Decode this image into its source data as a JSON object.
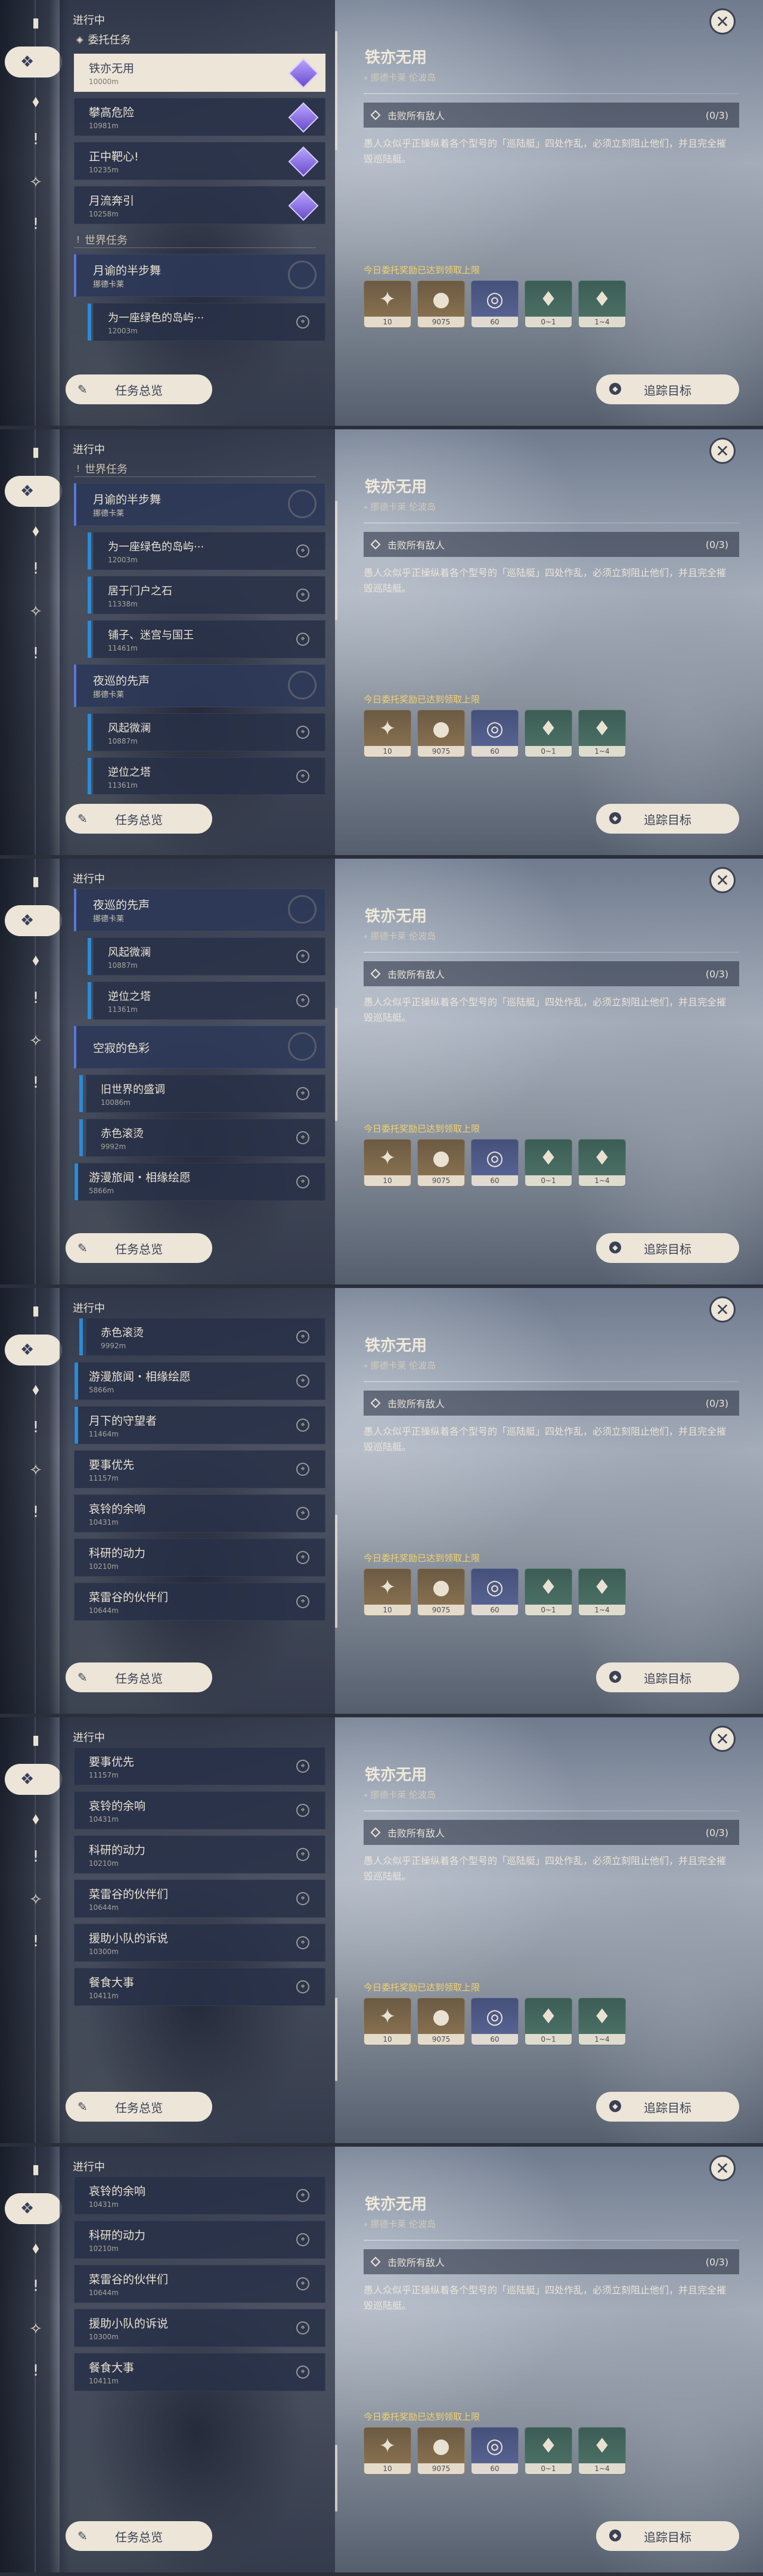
{
  "common": {
    "rail_icons": [
      {
        "name": "book-icon",
        "glyph": "▮"
      },
      {
        "name": "commission-icon",
        "glyph": "❖"
      },
      {
        "name": "archon-icon",
        "glyph": "⬧"
      },
      {
        "name": "exclamation-icon",
        "glyph": "!"
      },
      {
        "name": "crystal-icon",
        "glyph": "✧"
      },
      {
        "name": "exclamation-icon-2",
        "glyph": "!"
      }
    ],
    "in_progress": "进行中",
    "overview_button": "任务总览",
    "track_button": "追踪目标",
    "close_symbol": "✕",
    "detail": {
      "title": "铁亦无用",
      "location": "挪德卡莱 伦波岛",
      "objective": "击败所有敌人",
      "objective_count": "(0/3)",
      "description": "愚人众似乎正操纵着各个型号的「巡陆艇」四处作乱，必须立刻阻止他们，并且完全摧毁巡陆艇。",
      "rewards_label": "今日委托奖励已达到领取上限",
      "rewards": [
        {
          "icon": "star-icon",
          "glyph": "✦",
          "count": "10"
        },
        {
          "icon": "mora-icon",
          "glyph": "●",
          "count": "9075"
        },
        {
          "icon": "exp-icon",
          "glyph": "◎",
          "count": "60"
        },
        {
          "icon": "crystal-icon",
          "glyph": "♦",
          "count": "0~1"
        },
        {
          "icon": "crystal-cluster-icon",
          "glyph": "♦",
          "count": "1~4"
        }
      ]
    }
  },
  "frames": [
    {
      "thumb": "top",
      "items": [
        {
          "kind": "section",
          "icon": "◈",
          "text": "委托任务"
        },
        {
          "kind": "row",
          "style": "sel",
          "title": "铁亦无用",
          "dist": "10000m",
          "badge": "gem"
        },
        {
          "kind": "row",
          "style": "plain",
          "title": "攀高危险",
          "dist": "10981m",
          "badge": "gem"
        },
        {
          "kind": "row",
          "style": "plain",
          "title": "正中靶心!",
          "dist": "10235m",
          "badge": "gem"
        },
        {
          "kind": "row",
          "style": "plain",
          "title": "月流奔引",
          "dist": "10258m",
          "badge": "gem"
        },
        {
          "kind": "section",
          "icon": "!",
          "text": "世界任务",
          "sub": true
        },
        {
          "kind": "group",
          "title": "月谕的半步舞",
          "sub": "挪德卡莱"
        },
        {
          "kind": "child",
          "title": "为一座绿色的岛屿···",
          "dist": "12003m"
        }
      ]
    },
    {
      "thumb": "upper",
      "items": [
        {
          "kind": "section",
          "icon": "!",
          "text": "世界任务",
          "sub": true
        },
        {
          "kind": "group",
          "title": "月谕的半步舞",
          "sub": "挪德卡莱"
        },
        {
          "kind": "child",
          "title": "为一座绿色的岛屿···",
          "dist": "12003m"
        },
        {
          "kind": "child",
          "title": "居于门户之石",
          "dist": "11338m"
        },
        {
          "kind": "child",
          "title": "铺子、迷宫与国王",
          "dist": "11461m"
        },
        {
          "kind": "group",
          "title": "夜巡的先声",
          "sub": "挪德卡莱"
        },
        {
          "kind": "child",
          "title": "风起微澜",
          "dist": "10887m"
        },
        {
          "kind": "child",
          "title": "逆位之塔",
          "dist": "11361m"
        }
      ]
    },
    {
      "thumb": "middle",
      "items": [
        {
          "kind": "group",
          "title": "夜巡的先声",
          "sub": "挪德卡莱"
        },
        {
          "kind": "child",
          "title": "风起微澜",
          "dist": "10887m"
        },
        {
          "kind": "child",
          "title": "逆位之塔",
          "dist": "11361m"
        },
        {
          "kind": "group",
          "title": "空寂的色彩",
          "sub": ""
        },
        {
          "kind": "child",
          "title": "旧世界的盛调",
          "dist": "10086m",
          "plain": true
        },
        {
          "kind": "child",
          "title": "赤色滚烫",
          "dist": "9992m",
          "plain": true
        },
        {
          "kind": "row",
          "style": "blue",
          "title": "游漫旅闻・相缘绘愿",
          "dist": "5866m"
        }
      ]
    },
    {
      "thumb": "lower",
      "items": [
        {
          "kind": "child",
          "title": "赤色滚烫",
          "dist": "9992m",
          "plain": true
        },
        {
          "kind": "row",
          "style": "blue",
          "title": "游漫旅闻・相缘绘愿",
          "dist": "5866m"
        },
        {
          "kind": "row",
          "style": "blue",
          "title": "月下的守望者",
          "dist": "11464m"
        },
        {
          "kind": "row",
          "style": "plain",
          "title": "要事优先",
          "dist": "11157m"
        },
        {
          "kind": "row",
          "style": "plain",
          "title": "哀铃的余响",
          "dist": "10431m"
        },
        {
          "kind": "row",
          "style": "plain",
          "title": "科研的动力",
          "dist": "10210m"
        },
        {
          "kind": "row",
          "style": "plain",
          "title": "菜雷谷的伙伴们",
          "dist": "10644m"
        }
      ]
    },
    {
      "thumb": "bottom",
      "items": [
        {
          "kind": "row",
          "style": "plain",
          "title": "要事优先",
          "dist": "11157m"
        },
        {
          "kind": "row",
          "style": "plain",
          "title": "哀铃的余响",
          "dist": "10431m"
        },
        {
          "kind": "row",
          "style": "plain",
          "title": "科研的动力",
          "dist": "10210m"
        },
        {
          "kind": "row",
          "style": "plain",
          "title": "菜雷谷的伙伴们",
          "dist": "10644m"
        },
        {
          "kind": "row",
          "style": "plain",
          "title": "援助小队的诉说",
          "dist": "10300m"
        },
        {
          "kind": "row",
          "style": "plain",
          "title": "餐食大事",
          "dist": "10411m"
        }
      ]
    },
    {
      "thumb": "end",
      "items": [
        {
          "kind": "row",
          "style": "plain",
          "title": "哀铃的余响",
          "dist": "10431m"
        },
        {
          "kind": "row",
          "style": "plain",
          "title": "科研的动力",
          "dist": "10210m"
        },
        {
          "kind": "row",
          "style": "plain",
          "title": "菜雷谷的伙伴们",
          "dist": "10644m"
        },
        {
          "kind": "row",
          "style": "plain",
          "title": "援助小队的诉说",
          "dist": "10300m"
        },
        {
          "kind": "row",
          "style": "plain",
          "title": "餐食大事",
          "dist": "10411m"
        }
      ]
    }
  ]
}
